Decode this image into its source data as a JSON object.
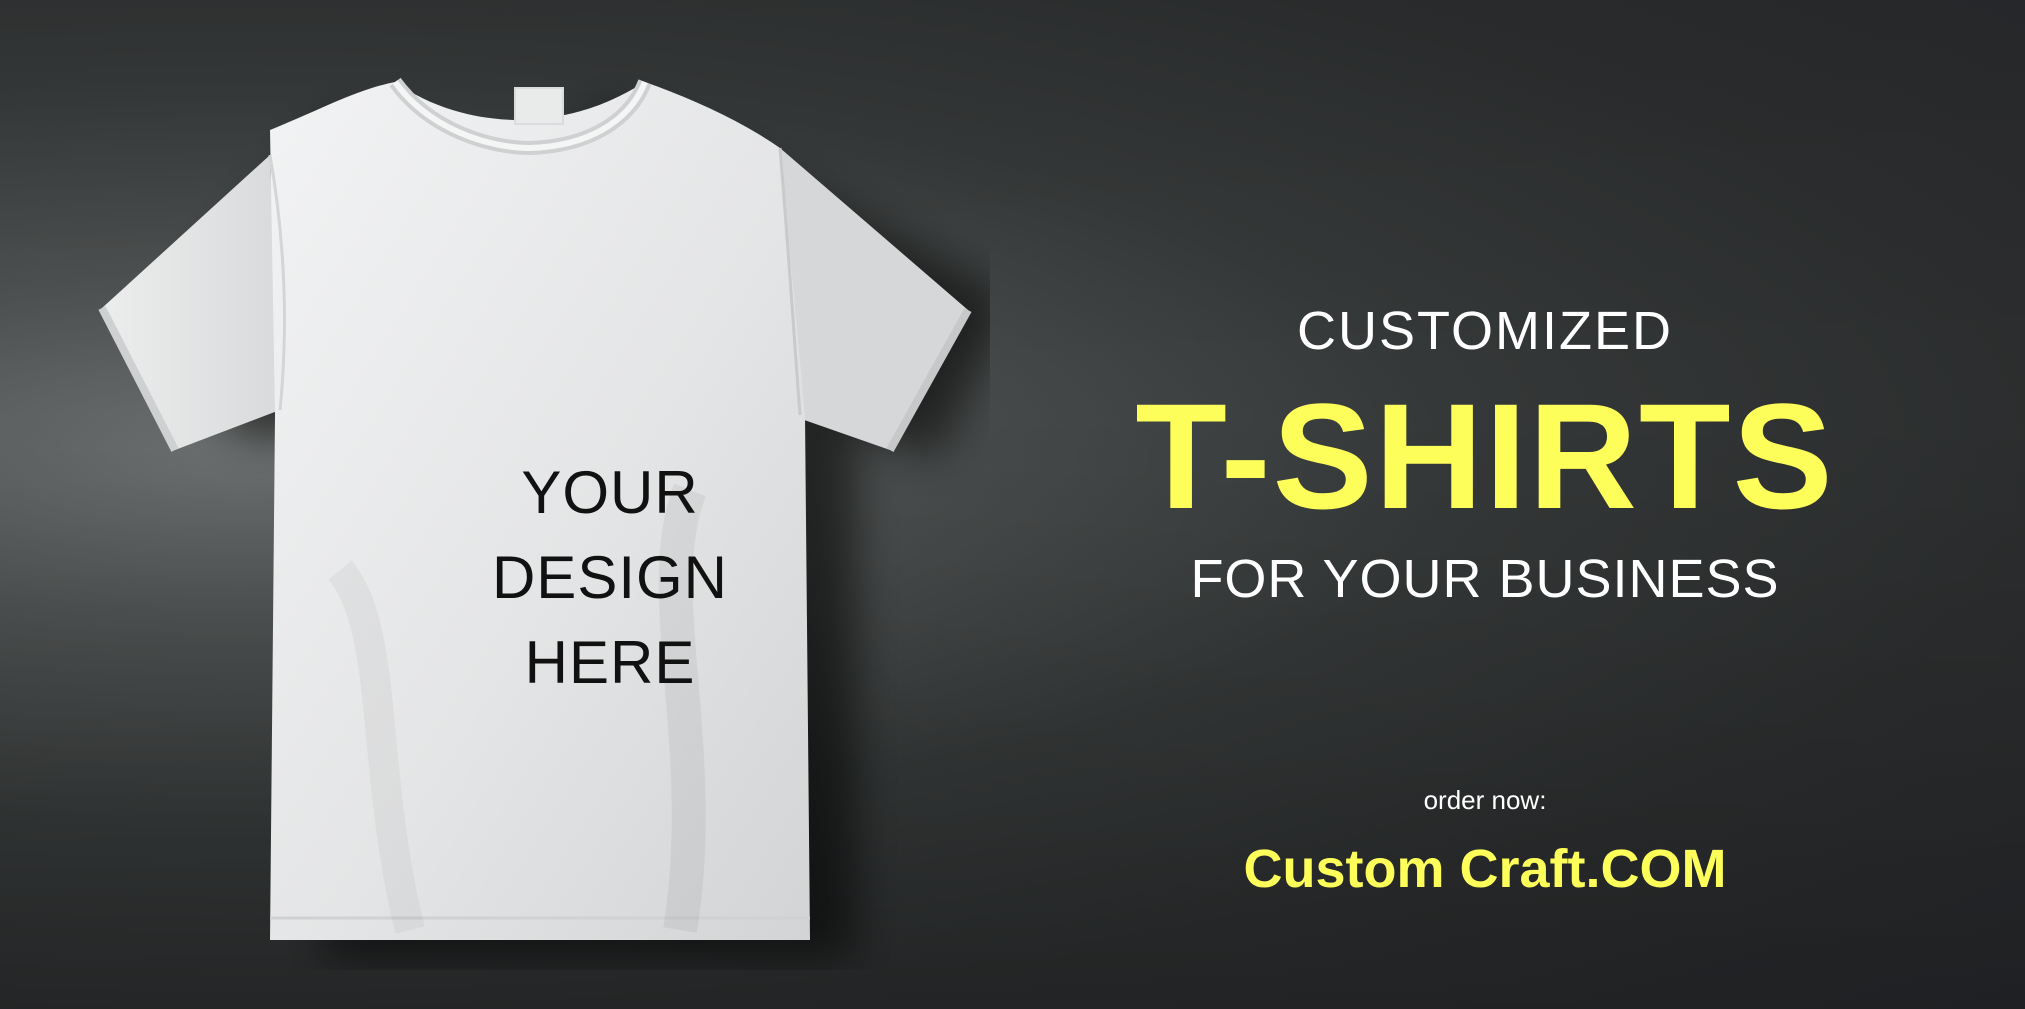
{
  "shirt": {
    "design_placeholder": [
      "YOUR",
      "DESIGN",
      "HERE"
    ],
    "color": "#e6e7e8"
  },
  "promo": {
    "line1": "CUSTOMIZED",
    "headline": "T-SHIRTS",
    "line3": "FOR YOUR BUSINESS",
    "cta_label": "order now:",
    "website": "Custom Craft.COM"
  },
  "colors": {
    "accent_yellow": "#fefe5a",
    "text_white": "#ffffff",
    "background_dark": "#2b2d2e"
  }
}
